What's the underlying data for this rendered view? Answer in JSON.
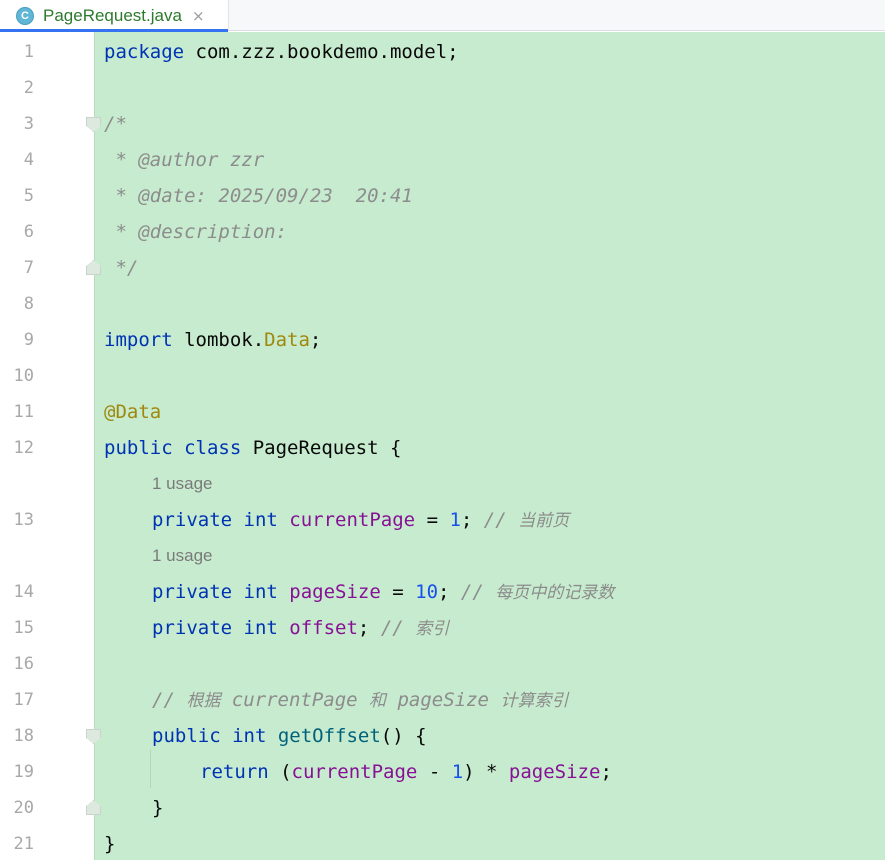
{
  "tab": {
    "icon_letter": "C",
    "filename": "PageRequest.java",
    "close_glyph": "×"
  },
  "colors": {
    "editor_background": "#c7ebcf",
    "keyword": "#0033b3",
    "annotation": "#9e880d",
    "field": "#871094",
    "number": "#1750eb",
    "comment": "#8c8c8c",
    "tab_label": "#2d7a2d"
  },
  "line_numbers": [
    "1",
    "2",
    "3",
    "4",
    "5",
    "6",
    "7",
    "8",
    "9",
    "10",
    "11",
    "12",
    "13",
    "14",
    "15",
    "16",
    "17",
    "18",
    "19",
    "20",
    "21"
  ],
  "code": {
    "l1": {
      "kw": "package",
      "rest": " com.zzz.bookdemo.model;"
    },
    "l3": {
      "cmt": "/*"
    },
    "l4": {
      "cmt": " * @author zzr"
    },
    "l5": {
      "cmt": " * @date: 2025/09/23  20:41"
    },
    "l6": {
      "cmt": " * @description:"
    },
    "l7": {
      "cmt": " */"
    },
    "l9": {
      "kw": "import",
      "pkg": " lombok.",
      "cls": "Data",
      "end": ";"
    },
    "l11": {
      "ann": "@Data"
    },
    "l12": {
      "kw1": "public",
      "kw2": " class",
      "name": " PageRequest {"
    },
    "hint13": "1 usage",
    "l13": {
      "kw1": "private",
      "kw2": " int",
      "field": " currentPage",
      "eq": " = ",
      "num": "1",
      "semi": "; ",
      "cmt": "// ",
      "cmt_text": "当前页"
    },
    "hint14": "1 usage",
    "l14": {
      "kw1": "private",
      "kw2": " int",
      "field": " pageSize",
      "eq": " = ",
      "num": "10",
      "semi": "; ",
      "cmt": "// ",
      "cmt_text": "每页中的记录数"
    },
    "l15": {
      "kw1": "private",
      "kw2": " int",
      "field": " offset",
      "semi": "; ",
      "cmt": "// ",
      "cmt_text": "索引"
    },
    "l17": {
      "cmt1": "// ",
      "cjk1": "根据",
      "cmt2": " currentPage ",
      "cjk2": "和",
      "cmt3": " pageSize ",
      "cjk3": "计算索引"
    },
    "l18": {
      "kw1": "public",
      "kw2": " int",
      "method": " getOffset",
      "end": "() {"
    },
    "l19": {
      "kw": "return",
      "p1": " (",
      "f1": "currentPage",
      "op": " - ",
      "num": "1",
      "p2": ") * ",
      "f2": "pageSize",
      "end": ";"
    },
    "l20": {
      "text": "}"
    },
    "l21": {
      "text": "}"
    }
  }
}
